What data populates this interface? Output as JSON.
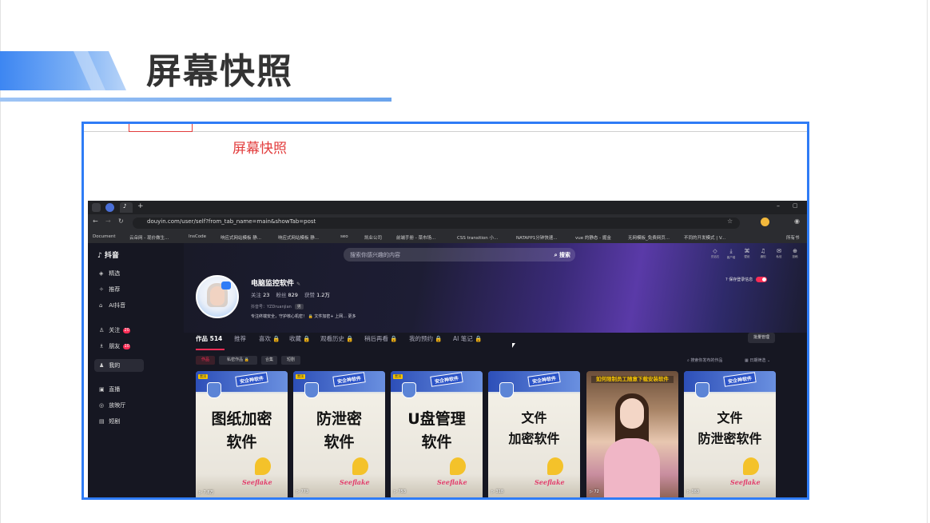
{
  "slide": {
    "title": "屏幕快照",
    "annotation": "屏幕快照",
    "accent_color": "#2f7cf6",
    "annotation_color": "#e23c3c"
  },
  "browser": {
    "url": "douyin.com/user/self?from_tab_name=main&showTab=post",
    "bookmarks": [
      "Document",
      "云朵网 - 现价做生...",
      "InsCode",
      "响应式网站模板 静...",
      "响应式网站模板 静...",
      "seo",
      "凯业公司",
      "前端手册 - 菜市场...",
      "CSS transition 小...",
      "NATAPP1分钟快速...",
      "vue 的静态 - 掘金",
      "无网模板_免费网页...",
      "不同的开发模式 | V..."
    ],
    "more_bookmarks": "所有书"
  },
  "douyin": {
    "logo": "抖音",
    "search_placeholder": "搜索你感兴趣的内容",
    "search_button": "搜索",
    "nav": [
      {
        "icon": "◈",
        "label": "精选"
      },
      {
        "icon": "✧",
        "label": "推荐"
      },
      {
        "icon": "⌂",
        "label": "AI抖音"
      },
      {
        "icon": "♙",
        "label": "关注",
        "badge": "20"
      },
      {
        "icon": "♗",
        "label": "朋友",
        "badge": "10"
      },
      {
        "icon": "♟",
        "label": "我的"
      },
      {
        "icon": "▣",
        "label": "直播"
      },
      {
        "icon": "◎",
        "label": "放映厅"
      },
      {
        "icon": "▤",
        "label": "短剧"
      }
    ],
    "top_icons": [
      {
        "icon": "◇",
        "label": "充钻石"
      },
      {
        "icon": "⤓",
        "label": "客户端"
      },
      {
        "icon": "⌘",
        "label": "壁纸"
      },
      {
        "icon": "♫",
        "label": "通知"
      },
      {
        "icon": "✉",
        "label": "私信"
      },
      {
        "icon": "⊕",
        "label": "投稿"
      }
    ],
    "profile": {
      "name": "电脑监控软件",
      "following_label": "关注",
      "following": "23",
      "followers_label": "粉丝",
      "followers": "829",
      "likes_label": "获赞",
      "likes": "1.2万",
      "account_label": "抖音号：YZDruanjian",
      "account_tag": "男",
      "bio": "专注终端安全，守护核心机密！ 🔒 文件加密+ 上网... 更多"
    },
    "privacy_label": "保存登录信息",
    "tabs": [
      {
        "label": "作品 514",
        "active": true
      },
      {
        "label": "推荐"
      },
      {
        "label": "喜欢 🔒"
      },
      {
        "label": "收藏 🔒"
      },
      {
        "label": "观看历史 🔒"
      },
      {
        "label": "稍后再看 🔒"
      },
      {
        "label": "我的预约 🔒"
      },
      {
        "label": "AI 笔记 🔒"
      }
    ],
    "batch_button": "批量管理",
    "chips": [
      "作品",
      "私密作品 🔒",
      "合集",
      "短剧"
    ],
    "filter_search": "搜索你发布的作品",
    "filter_date": "日期筛选",
    "cards": [
      {
        "title_lines": [
          "图纸加密",
          "软件"
        ],
        "header": "安企神软件",
        "tag": "置顶",
        "plays": "7.8万",
        "sig": "Seeflake"
      },
      {
        "title_lines": [
          "防泄密",
          "软件"
        ],
        "header": "安企神软件",
        "tag": "置顶",
        "plays": "773",
        "sig": "Seeflake"
      },
      {
        "title_lines": [
          "U盘管理",
          "软件"
        ],
        "header": "安企神软件",
        "tag": "置顶",
        "plays": "753",
        "sig": "Seeflake"
      },
      {
        "title_lines": [
          "文件",
          "加密软件"
        ],
        "header": "安企神软件",
        "plays": "318",
        "sig": "Seeflake"
      },
      {
        "caption": "如何限制员工随意下载安装软件",
        "plays": "72",
        "photo": true
      },
      {
        "title_lines": [
          "文件",
          "防泄密软件"
        ],
        "header": "安企神软件",
        "plays": "383",
        "sig": "Seeflake"
      }
    ]
  }
}
